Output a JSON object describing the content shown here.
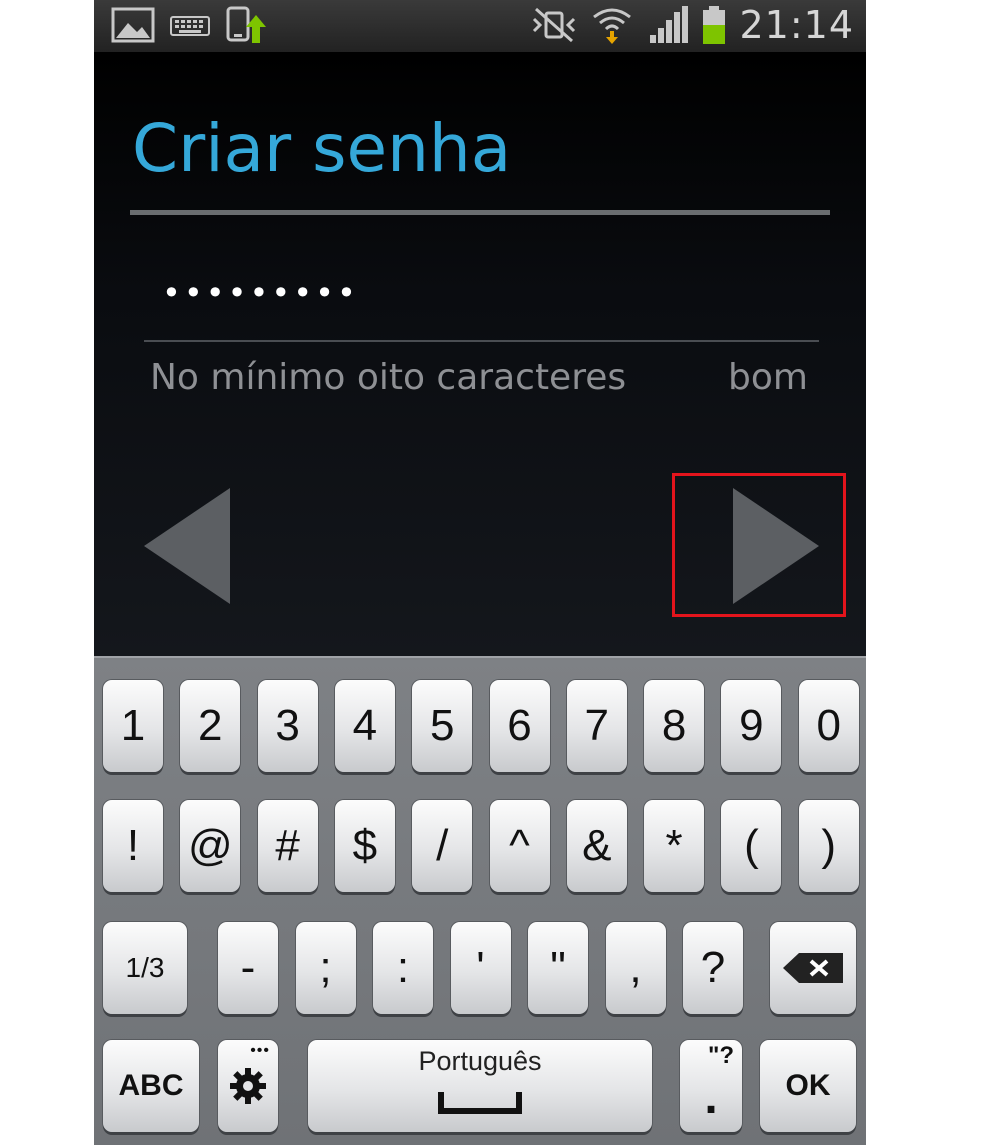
{
  "status_bar": {
    "time": "21:14",
    "icons": [
      "image-icon",
      "keyboard-icon",
      "usb-upload-icon",
      "mute-vibrate-icon",
      "wifi-icon",
      "signal-icon",
      "battery-icon"
    ],
    "battery_color": "#7ec400"
  },
  "screen": {
    "title": "Criar senha",
    "password_mask": "•••••••••",
    "hint": "No mínimo oito caracteres",
    "strength": "bom",
    "accent_color": "#35a8d9",
    "highlight_color": "#e3141c"
  },
  "keyboard": {
    "row1": [
      "1",
      "2",
      "3",
      "4",
      "5",
      "6",
      "7",
      "8",
      "9",
      "0"
    ],
    "row2": [
      "!",
      "@",
      "#",
      "$",
      "/",
      "^",
      "&",
      "*",
      "(",
      ")"
    ],
    "row3": {
      "page": "1/3",
      "keys": [
        "-",
        ";",
        ":",
        "'",
        "\"",
        ",",
        "?"
      ],
      "backspace_icon": "backspace-icon"
    },
    "row4": {
      "abc": "ABC",
      "settings_icon": "gear-icon",
      "space_label": "Português",
      "period_hint": "\"?",
      "period": ".",
      "ok": "OK"
    }
  }
}
